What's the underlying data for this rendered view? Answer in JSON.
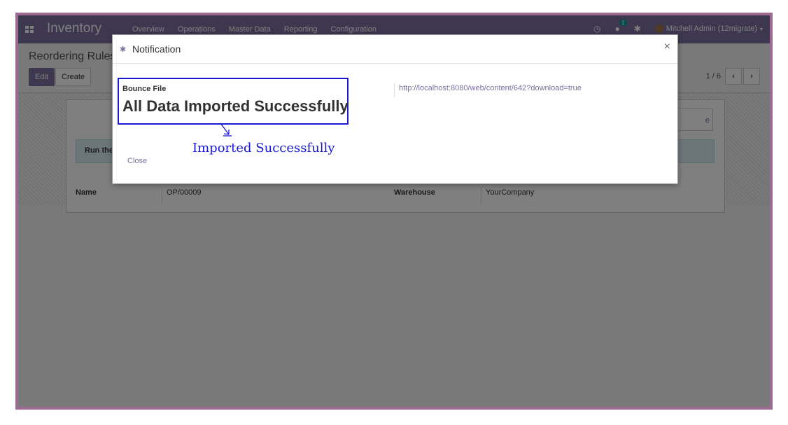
{
  "navbar": {
    "app_title": "Inventory",
    "menu": [
      "Overview",
      "Operations",
      "Master Data",
      "Reporting",
      "Configuration"
    ],
    "chat_badge": "1",
    "user": "Mitchell Admin (12migrate)"
  },
  "control_panel": {
    "title": "Reordering Rules",
    "edit_label": "Edit",
    "create_label": "Create",
    "pager": "1 / 6"
  },
  "form": {
    "run_label": "Run the",
    "stat_fragment": "e",
    "name_label": "Name",
    "name_value": "OP/00009",
    "warehouse_label": "Warehouse",
    "warehouse_value": "YourCompany"
  },
  "modal": {
    "title": "Notification",
    "bounce_label": "Bounce File",
    "success_message": "All Data Imported Successfully",
    "download_url": "http://localhost:8080/web/content/642?download=true",
    "close_label": "Close"
  },
  "annotation": {
    "text": "Imported  Successfully",
    "color": "#1a1ad6"
  },
  "colors": {
    "brand": "#7c6fa0",
    "frame": "#9b6b94"
  }
}
